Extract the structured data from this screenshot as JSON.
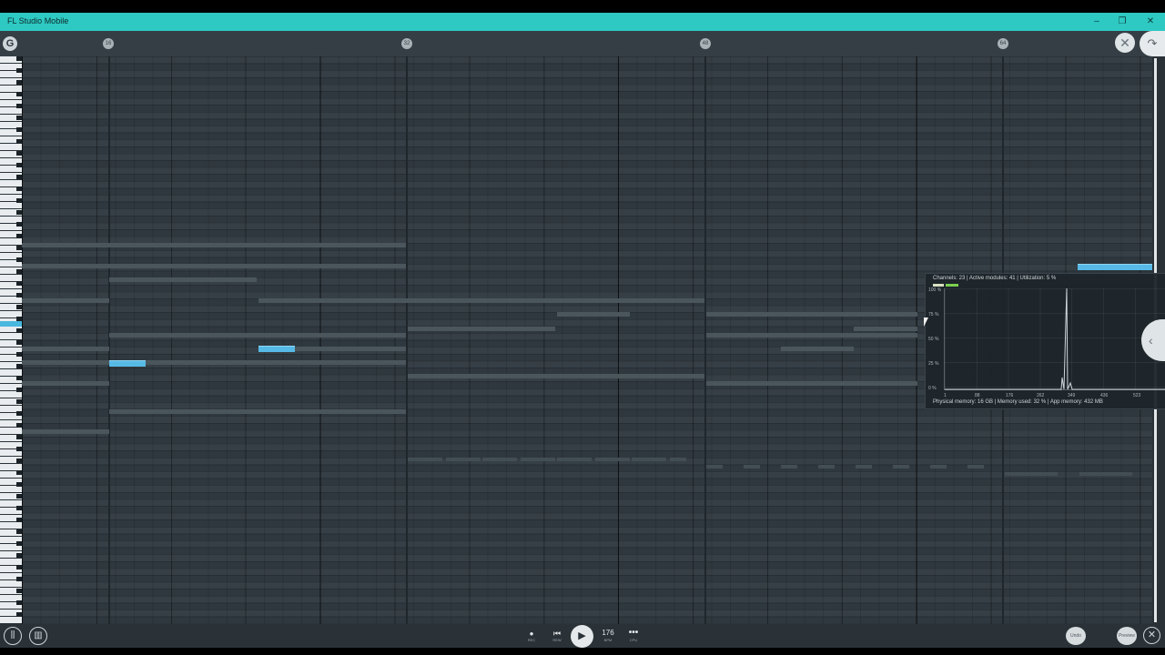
{
  "window": {
    "title": "FL Studio Mobile",
    "minimize_glyph": "–",
    "restore_glyph": "❐",
    "close_glyph": "✕"
  },
  "ruler": {
    "logo_glyph": "G",
    "marker_labels": [
      "16",
      "32",
      "48",
      "64"
    ]
  },
  "cpu_monitor": {
    "header": "Channels: 23 | Active modules: 41 | Utilization:  5 %",
    "y_ticks": [
      "100 %",
      "75 %",
      "50 %",
      "25 %",
      "0 %"
    ],
    "x_ticks": [
      "1",
      "88",
      "176",
      "262",
      "349",
      "436",
      "523"
    ],
    "footer": "Physical memory: 16 GB | Memory used: 32 % | App memory: 432 MB"
  },
  "transport": {
    "rec_caption": "REC",
    "rew_caption": "REW",
    "tempo": "176",
    "bpm_caption": "BPM",
    "more_caption": "CPU",
    "undo_label": "Undo",
    "preview_label": "Preview"
  },
  "icons": {
    "mixer": "mixer-icon",
    "piano": "piano-icon",
    "play": "play-icon",
    "record": "record-icon",
    "rewind": "rewind-icon",
    "more": "more-icon",
    "close": "close-icon",
    "side_tab": "chevron-left-icon"
  },
  "colors": {
    "titlebar": "#2ec9c3",
    "note": "#57b9e6",
    "grid_bg": "#2f383f",
    "ghost_note": "#4b555c"
  }
}
